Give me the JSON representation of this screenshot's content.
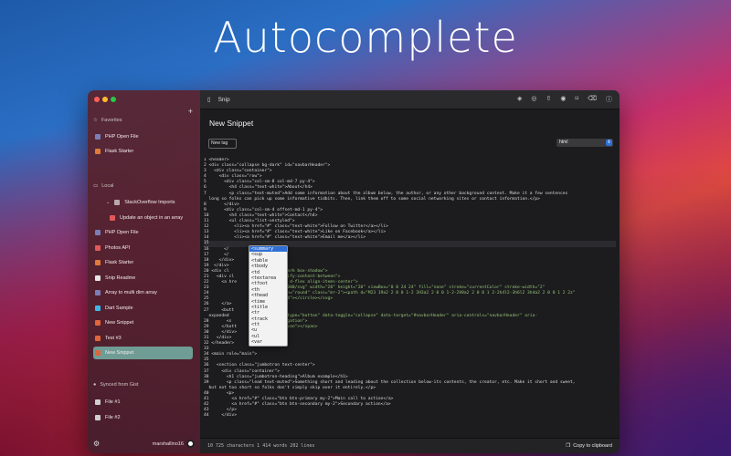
{
  "hero": {
    "title": "Autocomplete"
  },
  "sidebar": {
    "favorites_label": "Favorites",
    "favorites": [
      {
        "label": "PHP Open File",
        "icon": "php-icon",
        "color": "#7b7fb5"
      },
      {
        "label": "Flask Starter",
        "icon": "flask-icon",
        "color": "#e07b39"
      }
    ],
    "local_label": "Local",
    "local": [
      {
        "label": "StackOverflow Imports",
        "icon": "folder-icon",
        "color": "#b9a9a9",
        "level": 1
      },
      {
        "label": "Update an object in an array",
        "icon": "js-icon",
        "color": "#e05a5a",
        "level": 2
      },
      {
        "label": "PHP Open File",
        "icon": "php-icon",
        "color": "#7b7fb5",
        "level": 0
      },
      {
        "label": "Photos API",
        "icon": "js-icon",
        "color": "#e05a5a",
        "level": 0
      },
      {
        "label": "Flask Starter",
        "icon": "flask-icon",
        "color": "#e07b39",
        "level": 0
      },
      {
        "label": "Snip Readme",
        "icon": "markdown-icon",
        "color": "#e6e6e6",
        "level": 0
      },
      {
        "label": "Array to multi dim array",
        "icon": "php-icon",
        "color": "#7b7fb5",
        "level": 0
      },
      {
        "label": "Dart Sample",
        "icon": "dart-icon",
        "color": "#3fb6e8",
        "level": 0
      },
      {
        "label": "New Snippet",
        "icon": "html-icon",
        "color": "#e0663a",
        "level": 0
      },
      {
        "label": "Test #3",
        "icon": "html-icon",
        "color": "#e0663a",
        "level": 0
      },
      {
        "label": "New Snippet",
        "icon": "html-icon",
        "color": "#e0663a",
        "level": 0,
        "selected": true
      }
    ],
    "gist_label": "Synced from Gist",
    "gist": [
      {
        "label": "File #1",
        "icon": "file-icon"
      },
      {
        "label": "File #2",
        "icon": "file-icon"
      }
    ],
    "username": "marshallino16"
  },
  "toolbar": {
    "app_name": "Snip",
    "actions": [
      "layers-icon",
      "share-gist-icon",
      "export-icon",
      "preview-icon",
      "bookmark-icon",
      "trash-icon",
      "info-icon"
    ]
  },
  "snippet": {
    "title": "New Snippet",
    "tag_placeholder": "New tag",
    "language": "html"
  },
  "code_lines": [
    "1 <header>",
    "2 <div class=\"collapse bg-dark\" id=\"navbarHeader\">",
    "3   <div class=\"container\">",
    "4     <div class=\"row\">",
    "5       <div class=\"col-sm-8 col-md-7 py-4\">",
    "6         <h4 class=\"text-white\">About</h4>",
    "7         <p class=\"text-muted\">Add some information about the album below, the author, or any other background context. Make it a few sentences",
    "  long so folks can pick up some informative tidbits. Then, link them off to some social networking sites or contact information.</p>",
    "8       </div>",
    "9       <div class=\"col-sm-4 offset-md-1 py-4\">",
    "10        <h4 class=\"text-white\">Contact</h4>",
    "11        <ul class=\"list-unstyled\">",
    "12          <li><a href=\"#\" class=\"text-white\">Follow on Twitter</a></li>",
    "13          <li><a href=\"#\" class=\"text-white\">Like on Facebook</a></li>",
    "14          <li><a href=\"#\" class=\"text-white\">Email me</a></li>",
    "15",
    "16      </",
    "17      </",
    "18    </div>",
    "19  </div>",
    "20 <div cl",
    "21   <div cl",
    "22     <a hre",
    "23",
    "24",
    "25",
    "26     </a>",
    "27     <butt",
    "  expanded",
    "28       <s",
    "29     </butt",
    "30     </div>",
    "31   </div>",
    "32 </header>",
    "33",
    "34 <main role=\"main\">",
    "35",
    "36   <section class=\"jumbotron text-center\">",
    "37     <div class=\"container\">",
    "38       <h1 class=\"jumbotron-heading\">Album example</h1>",
    "39       <p class=\"lead text-muted\">Something short and leading about the collection below-its contents, the creator, etc. Make it short and sweet,",
    "  but not too short so folks don't simply skip over it entirely.</p>",
    "40       <p>",
    "41         <a href=\"#\" class=\"btn btn-primary my-2\">Main call to action</a>",
    "42         <a href=\"#\" class=\"btn btn-secondary my-2\">Secondary action</a>",
    "43       </p>",
    "44     </div>"
  ],
  "code_tails": [
    "",
    "",
    "",
    "",
    "",
    "",
    "",
    "",
    "",
    "",
    "",
    "",
    "",
    "",
    "",
    "",
    "",
    "",
    "",
    "",
    "r-dark bg-dark box-shadow\">",
    "d-flex justify-content-between\">",
    "avbar-brand d-flex align-items-center\">",
    "ww.w3.org/2000/svg\" width=\"20\" height=\"20\" viewBox=\"0 0 24 24\" fill=\"none\" stroke=\"currentColor\" stroke-width=\"2\"",
    "oke-linejoin=\"round\" class=\"mr-2\"><path d=\"M23 19a2 2 0 0 1-2 2H3a2 2 0 0 1-2-2V8a2 2 0 0 1 2-2h4l2-3h6l2 3h4a2 2 0 0 1 2 2z\"",
    "cy=\"13\" r=\"4\"></circle></svg>",
    "",
    "",
    "r-toggler\" type=\"button\" data-toggle=\"collapse\" data-target=\"#navbarHeader\" aria-controls=\"navbarHeader\" aria-",
    "Toggle navigation\">",
    "r-toggler-icon\"></span>"
  ],
  "autocomplete": {
    "options": [
      "<summary",
      "<sup",
      "<table",
      "<tbody",
      "<td",
      "<textarea",
      "<tfoot",
      "<th",
      "<thead",
      "<time",
      "<title",
      "<tr",
      "<track",
      "<tt",
      "<u",
      "<ul",
      "<var"
    ],
    "active_index": 0
  },
  "status": {
    "stats": "10 725 characters  1 414 words  202 lines",
    "copy_label": "Copy to clipboard"
  }
}
